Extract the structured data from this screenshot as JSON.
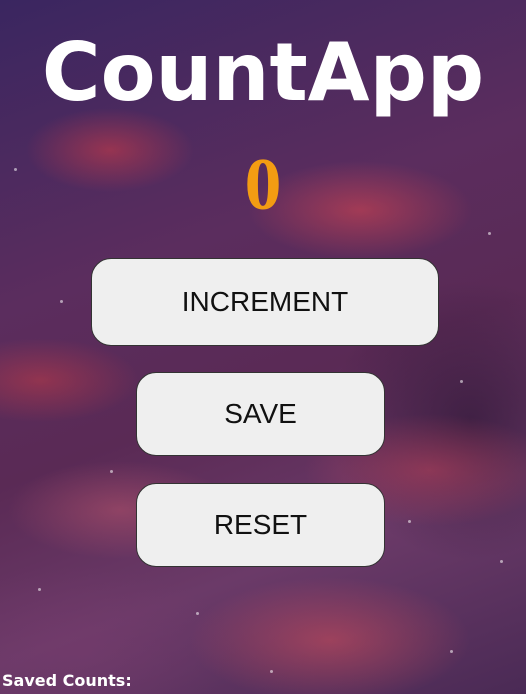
{
  "app": {
    "title": "CountApp",
    "count": "0"
  },
  "buttons": {
    "increment_label": "INCREMENT",
    "save_label": "SAVE",
    "reset_label": "RESET"
  },
  "saved": {
    "label": "Saved Counts:",
    "entries": []
  },
  "colors": {
    "title_text": "#ffffff",
    "counter_text": "#f39c12",
    "button_bg": "#efefef",
    "button_border": "#333333",
    "background_primary": "#4a2a5a",
    "background_accent": "#d24650"
  }
}
